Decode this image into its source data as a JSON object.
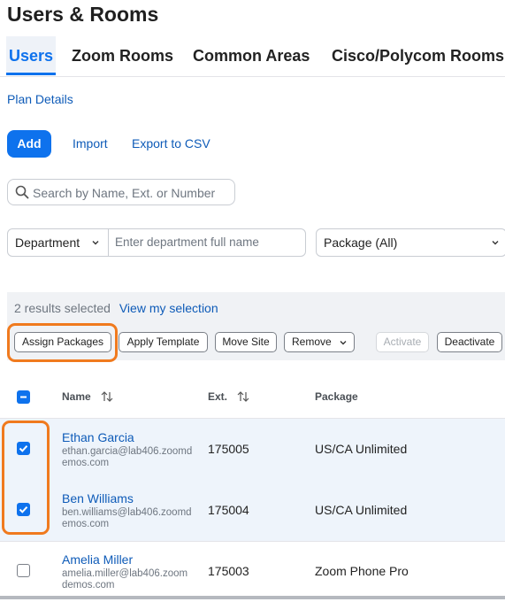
{
  "page": {
    "title": "Users & Rooms"
  },
  "tabs": [
    {
      "label": "Users",
      "active": true
    },
    {
      "label": "Zoom Rooms"
    },
    {
      "label": "Common Areas"
    },
    {
      "label": "Cisco/Polycom Rooms"
    }
  ],
  "plan_details_link": "Plan Details",
  "actions": {
    "add": "Add",
    "import": "Import",
    "export": "Export to CSV"
  },
  "search": {
    "placeholder": "Search by Name, Ext. or Number",
    "icon": "search-icon"
  },
  "filters": {
    "department_select": "Department",
    "department_placeholder": "Enter department full name",
    "package_select": "Package (All)"
  },
  "selection": {
    "count_text": "2 results selected",
    "view_link": "View my selection",
    "buttons": {
      "assign_packages": "Assign Packages",
      "apply_template": "Apply Template",
      "move_site": "Move Site",
      "remove": "Remove",
      "activate": "Activate",
      "deactivate": "Deactivate"
    }
  },
  "table": {
    "headers": {
      "name": "Name",
      "ext": "Ext.",
      "package": "Package"
    },
    "rows": [
      {
        "name": "Ethan Garcia",
        "email": "ethan.garcia@lab406.zoomdemos.com",
        "ext": "175005",
        "package": "US/CA Unlimited",
        "checked": true
      },
      {
        "name": "Ben Williams",
        "email": "ben.williams@lab406.zoomdemos.com",
        "ext": "175004",
        "package": "US/CA Unlimited",
        "checked": true
      },
      {
        "name": "Amelia Miller",
        "email": "amelia.miller@lab406.zoomdemos.com",
        "ext": "175003",
        "package": "Zoom Phone Pro",
        "checked": false
      }
    ]
  },
  "colors": {
    "accent": "#0e72ed",
    "highlight": "#f07a1e",
    "link": "#0e5bb8"
  }
}
